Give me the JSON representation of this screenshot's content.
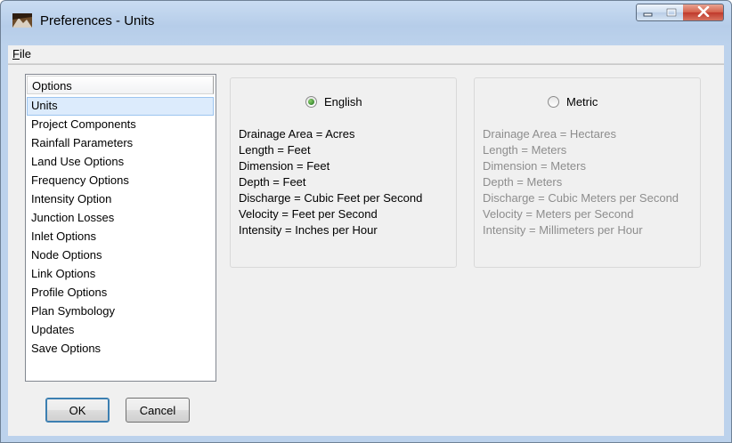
{
  "window": {
    "title": "Preferences - Units"
  },
  "menu": {
    "file": "File"
  },
  "options_list": {
    "header": "Options",
    "items": [
      "Units",
      "Project Components",
      "Rainfall Parameters",
      "Land Use Options",
      "Frequency Options",
      "Intensity Option",
      "Junction Losses",
      "Inlet Options",
      "Node Options",
      "Link Options",
      "Profile Options",
      "Plan Symbology",
      "Updates",
      "Save Options"
    ],
    "selected": "Units"
  },
  "buttons": {
    "ok": "OK",
    "cancel": "Cancel"
  },
  "english": {
    "label": "English",
    "checked": true,
    "lines": [
      "Drainage Area = Acres",
      "Length = Feet",
      "Dimension = Feet",
      "Depth = Feet",
      "Discharge = Cubic Feet per Second",
      "Velocity = Feet per Second",
      "Intensity = Inches per Hour"
    ]
  },
  "metric": {
    "label": "Metric",
    "checked": false,
    "lines": [
      "Drainage Area = Hectares",
      "Length = Meters",
      "Dimension = Meters",
      "Depth = Meters",
      "Discharge = Cubic Meters per Second",
      "Velocity = Meters per Second",
      "Intensity = Millimeters per Hour"
    ]
  },
  "icons": {
    "app": "preferences-app-icon",
    "minimize": "minimize-icon",
    "maximize": "maximize-icon",
    "close": "close-icon"
  }
}
